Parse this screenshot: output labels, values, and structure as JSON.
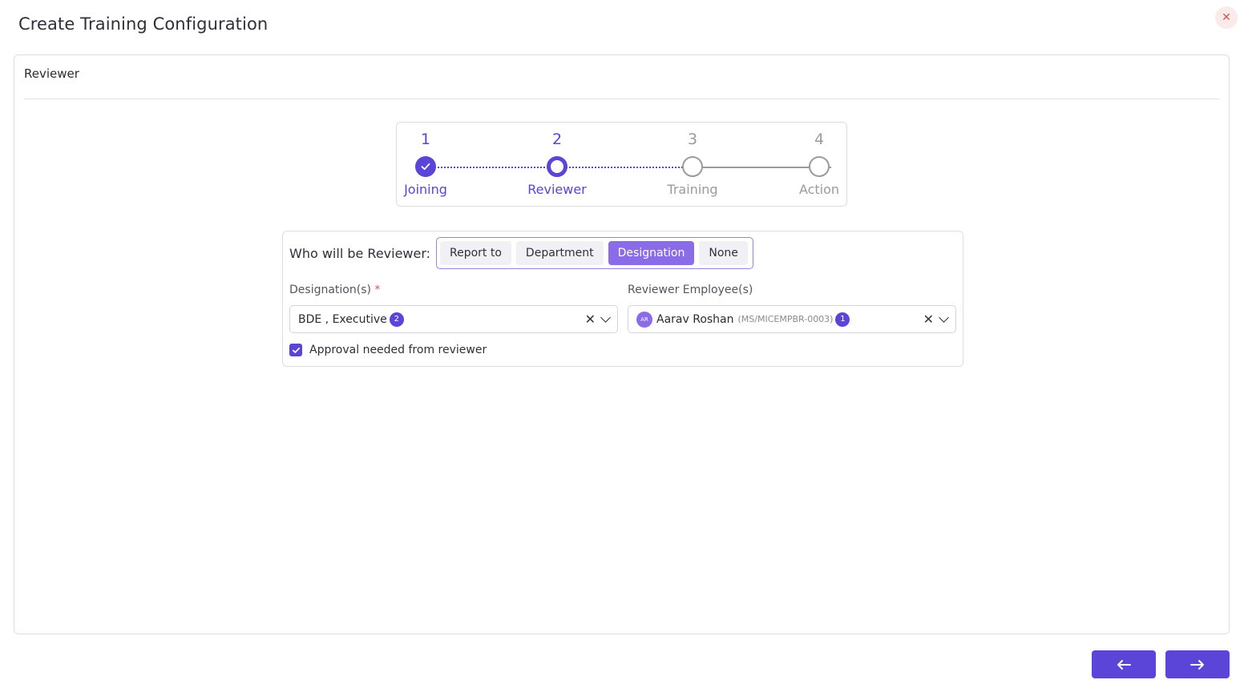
{
  "page": {
    "title": "Create Training Configuration",
    "close_icon": "close-icon",
    "close_symbol": "✕"
  },
  "section": {
    "title": "Reviewer"
  },
  "stepper": {
    "steps": [
      {
        "number": "1",
        "label": "Joining",
        "state": "done"
      },
      {
        "number": "2",
        "label": "Reviewer",
        "state": "active"
      },
      {
        "number": "3",
        "label": "Training",
        "state": "todo"
      },
      {
        "number": "4",
        "label": "Action",
        "state": "todo"
      }
    ]
  },
  "reviewer": {
    "question": "Who will be Reviewer:",
    "options": [
      "Report to",
      "Department",
      "Designation",
      "None"
    ],
    "selected": "Designation"
  },
  "designation": {
    "label": "Designation(s)",
    "required_mark": "*",
    "value": "BDE , Executive",
    "count": "2"
  },
  "reviewer_employee": {
    "label": "Reviewer Employee(s)",
    "avatar_initials": "AR",
    "name": "Aarav Roshan",
    "code": "(MS/MICEMPBR-0003)",
    "count": "1"
  },
  "approval": {
    "label": "Approval needed from reviewer",
    "checked": true
  },
  "colors": {
    "accent": "#5b44d8",
    "accent_light": "#8a6ce8",
    "close": "#d9534f"
  },
  "navigation": {
    "back_icon": "arrow-left-icon",
    "next_icon": "arrow-right-icon"
  }
}
